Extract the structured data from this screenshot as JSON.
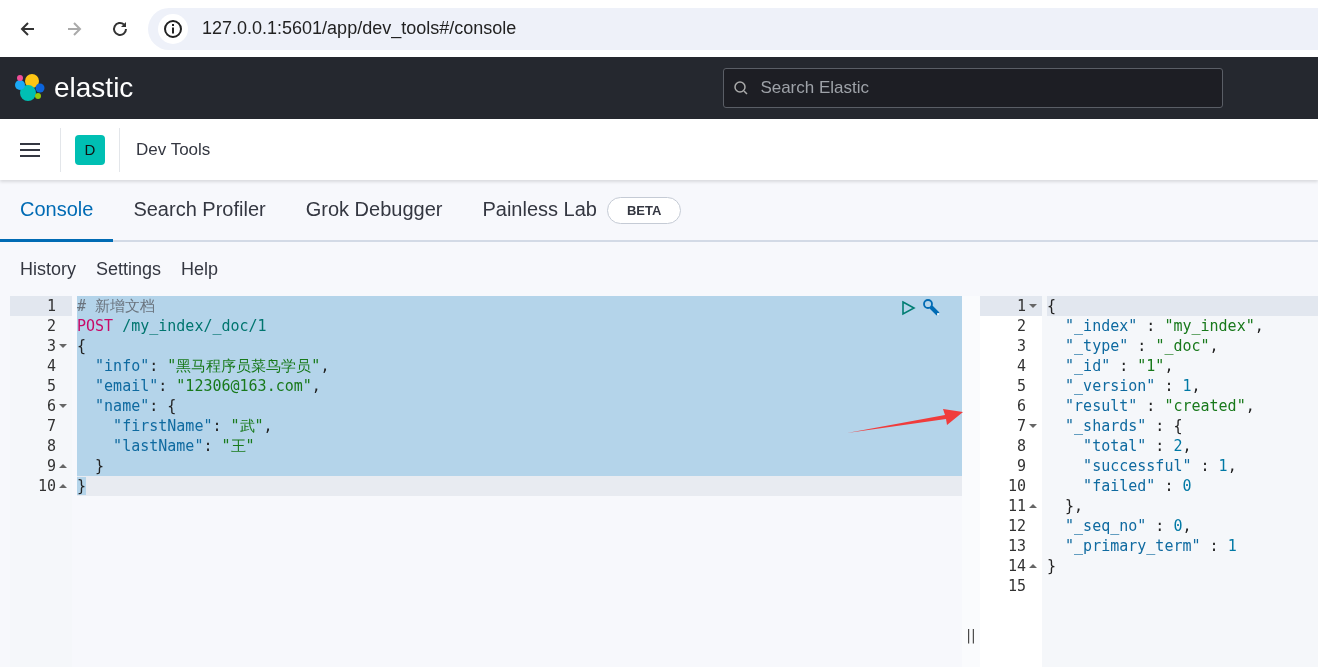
{
  "browser": {
    "url": "127.0.0.1:5601/app/dev_tools#/console"
  },
  "header": {
    "logo_text": "elastic",
    "search": {
      "placeholder": "Search Elastic"
    }
  },
  "breadcrumb": {
    "space_badge": "D",
    "title": "Dev Tools"
  },
  "tabs": [
    {
      "label": "Console",
      "selected": true
    },
    {
      "label": "Search Profiler",
      "selected": false
    },
    {
      "label": "Grok Debugger",
      "selected": false
    },
    {
      "label": "Painless Lab",
      "selected": false,
      "badge": "BETA"
    }
  ],
  "menu": [
    "History",
    "Settings",
    "Help"
  ],
  "request": {
    "lines": [
      {
        "number": "1",
        "active": true,
        "selected": true,
        "tokens": [
          {
            "kind": "comment",
            "text": "# 新增文档"
          }
        ]
      },
      {
        "number": "2",
        "selected": true,
        "tokens": [
          {
            "kind": "method",
            "text": "POST"
          },
          {
            "kind": "url",
            "text": " /my_index/_doc/1"
          }
        ]
      },
      {
        "number": "3",
        "fold_start": true,
        "selected": true,
        "tokens": [
          {
            "kind": "punct",
            "text": "{"
          }
        ]
      },
      {
        "number": "4",
        "selected": true,
        "tokens": [
          {
            "kind": "key",
            "text": "  \"info\""
          },
          {
            "kind": "punct",
            "text": ": "
          },
          {
            "kind": "string",
            "text": "\"黑马程序员菜鸟学员\""
          },
          {
            "kind": "punct",
            "text": ","
          }
        ]
      },
      {
        "number": "5",
        "selected": true,
        "tokens": [
          {
            "kind": "key",
            "text": "  \"email\""
          },
          {
            "kind": "punct",
            "text": ": "
          },
          {
            "kind": "string",
            "text": "\"12306@163.com\""
          },
          {
            "kind": "punct",
            "text": ","
          }
        ]
      },
      {
        "number": "6",
        "fold_start": true,
        "selected": true,
        "tokens": [
          {
            "kind": "key",
            "text": "  \"name\""
          },
          {
            "kind": "punct",
            "text": ": {"
          }
        ]
      },
      {
        "number": "7",
        "selected": true,
        "tokens": [
          {
            "kind": "key",
            "text": "    \"firstName\""
          },
          {
            "kind": "punct",
            "text": ": "
          },
          {
            "kind": "string",
            "text": "\"武\""
          },
          {
            "kind": "punct",
            "text": ","
          }
        ]
      },
      {
        "number": "8",
        "selected": true,
        "tokens": [
          {
            "kind": "key",
            "text": "    \"lastName\""
          },
          {
            "kind": "punct",
            "text": ": "
          },
          {
            "kind": "string",
            "text": "\"王\""
          }
        ]
      },
      {
        "number": "9",
        "fold_end": true,
        "selected": true,
        "tokens": [
          {
            "kind": "punct",
            "text": "  }"
          }
        ]
      },
      {
        "number": "10",
        "fold_end": true,
        "selected": true,
        "current": true,
        "tokens": [
          {
            "kind": "punct",
            "text": "}"
          }
        ]
      }
    ]
  },
  "response": {
    "lines": [
      {
        "number": "1",
        "fold_start": true,
        "active": true,
        "tokens": [
          {
            "kind": "punct",
            "text": "{"
          }
        ]
      },
      {
        "number": "2",
        "tokens": [
          {
            "kind": "key",
            "text": "  \"_index\""
          },
          {
            "kind": "punct",
            "text": " : "
          },
          {
            "kind": "string",
            "text": "\"my_index\""
          },
          {
            "kind": "punct",
            "text": ","
          }
        ]
      },
      {
        "number": "3",
        "tokens": [
          {
            "kind": "key",
            "text": "  \"_type\""
          },
          {
            "kind": "punct",
            "text": " : "
          },
          {
            "kind": "string",
            "text": "\"_doc\""
          },
          {
            "kind": "punct",
            "text": ","
          }
        ]
      },
      {
        "number": "4",
        "tokens": [
          {
            "kind": "key",
            "text": "  \"_id\""
          },
          {
            "kind": "punct",
            "text": " : "
          },
          {
            "kind": "string",
            "text": "\"1\""
          },
          {
            "kind": "punct",
            "text": ","
          }
        ]
      },
      {
        "number": "5",
        "tokens": [
          {
            "kind": "key",
            "text": "  \"_version\""
          },
          {
            "kind": "punct",
            "text": " : "
          },
          {
            "kind": "number",
            "text": "1"
          },
          {
            "kind": "punct",
            "text": ","
          }
        ]
      },
      {
        "number": "6",
        "tokens": [
          {
            "kind": "key",
            "text": "  \"result\""
          },
          {
            "kind": "punct",
            "text": " : "
          },
          {
            "kind": "string",
            "text": "\"created\""
          },
          {
            "kind": "punct",
            "text": ","
          }
        ]
      },
      {
        "number": "7",
        "fold_start": true,
        "tokens": [
          {
            "kind": "key",
            "text": "  \"_shards\""
          },
          {
            "kind": "punct",
            "text": " : {"
          }
        ]
      },
      {
        "number": "8",
        "tokens": [
          {
            "kind": "key",
            "text": "    \"total\""
          },
          {
            "kind": "punct",
            "text": " : "
          },
          {
            "kind": "number",
            "text": "2"
          },
          {
            "kind": "punct",
            "text": ","
          }
        ]
      },
      {
        "number": "9",
        "tokens": [
          {
            "kind": "key",
            "text": "    \"successful\""
          },
          {
            "kind": "punct",
            "text": " : "
          },
          {
            "kind": "number",
            "text": "1"
          },
          {
            "kind": "punct",
            "text": ","
          }
        ]
      },
      {
        "number": "10",
        "tokens": [
          {
            "kind": "key",
            "text": "    \"failed\""
          },
          {
            "kind": "punct",
            "text": " : "
          },
          {
            "kind": "number",
            "text": "0"
          }
        ]
      },
      {
        "number": "11",
        "fold_end": true,
        "tokens": [
          {
            "kind": "punct",
            "text": "  },"
          }
        ]
      },
      {
        "number": "12",
        "tokens": [
          {
            "kind": "key",
            "text": "  \"_seq_no\""
          },
          {
            "kind": "punct",
            "text": " : "
          },
          {
            "kind": "number",
            "text": "0"
          },
          {
            "kind": "punct",
            "text": ","
          }
        ]
      },
      {
        "number": "13",
        "tokens": [
          {
            "kind": "key",
            "text": "  \"_primary_term\""
          },
          {
            "kind": "punct",
            "text": " : "
          },
          {
            "kind": "number",
            "text": "1"
          }
        ]
      },
      {
        "number": "14",
        "fold_end": true,
        "tokens": [
          {
            "kind": "punct",
            "text": "}"
          }
        ]
      },
      {
        "number": "15"
      }
    ]
  },
  "resize_handle": "||"
}
